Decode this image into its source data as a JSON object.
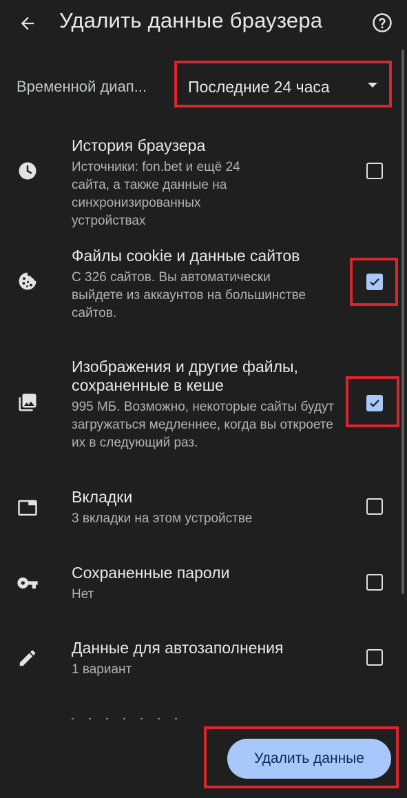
{
  "header": {
    "title": "Удалить данные браузера"
  },
  "time_range": {
    "label": "Временной диап...",
    "selected": "Последние 24 часа"
  },
  "items": [
    {
      "title": "История браузера",
      "desc": "Источники: fon.bet и ещё 24 сайта, а также данные на синхронизированных устройствах",
      "checked": false,
      "icon": "clock-icon"
    },
    {
      "title": "Файлы cookie и данные сайтов",
      "desc": "С 326 сайтов. Вы автоматически выйдете из аккаунтов на большинстве сайтов.",
      "checked": true,
      "icon": "cookie-icon"
    },
    {
      "title": "Изображения и другие файлы, сохраненные в кеше",
      "desc": "995 МБ. Возможно, некоторые сайты будут загружаться медленнее, когда вы откроете их в следующий раз.",
      "checked": true,
      "icon": "image-icon"
    },
    {
      "title": "Вкладки",
      "desc": "3 вкладки на этом устройстве",
      "checked": false,
      "icon": "tab-icon"
    },
    {
      "title": "Сохраненные пароли",
      "desc": "Нет",
      "checked": false,
      "icon": "key-icon"
    },
    {
      "title": "Данные для автозаполнения",
      "desc": "1 вариант",
      "checked": false,
      "icon": "pencil-icon"
    }
  ],
  "actions": {
    "delete_label": "Удалить данные"
  },
  "colors": {
    "background": "#1f1f1f",
    "accent": "#a8c7fa",
    "highlight": "#d8262f"
  }
}
